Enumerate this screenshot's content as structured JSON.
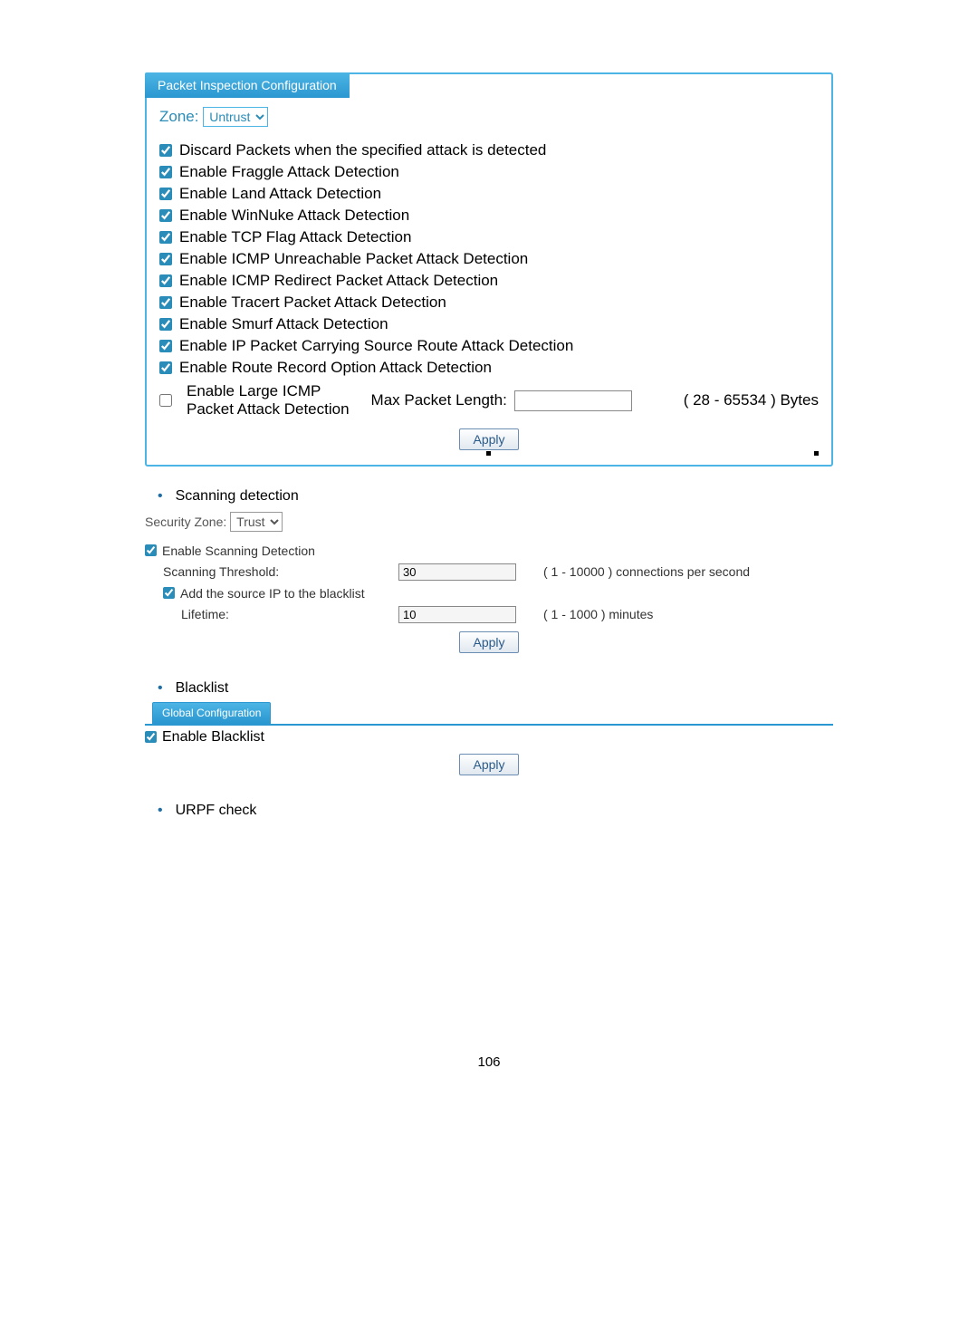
{
  "packetInspection": {
    "tabTitle": "Packet Inspection Configuration",
    "zoneLabel": "Zone:",
    "zoneValue": "Untrust",
    "options": [
      {
        "checked": true,
        "label": "Discard Packets when the specified attack is detected"
      },
      {
        "checked": true,
        "label": "Enable Fraggle Attack Detection"
      },
      {
        "checked": true,
        "label": "Enable Land Attack Detection"
      },
      {
        "checked": true,
        "label": "Enable WinNuke Attack Detection"
      },
      {
        "checked": true,
        "label": "Enable TCP Flag Attack Detection"
      },
      {
        "checked": true,
        "label": "Enable ICMP Unreachable Packet Attack Detection"
      },
      {
        "checked": true,
        "label": "Enable ICMP Redirect Packet Attack Detection"
      },
      {
        "checked": true,
        "label": "Enable Tracert Packet Attack Detection"
      },
      {
        "checked": true,
        "label": "Enable Smurf Attack Detection"
      },
      {
        "checked": true,
        "label": "Enable IP Packet Carrying Source Route Attack Detection"
      },
      {
        "checked": true,
        "label": "Enable Route Record Option Attack Detection"
      }
    ],
    "largeIcmp": {
      "checked": false,
      "labelLine1": "Enable Large ICMP",
      "labelLine2": "Packet Attack Detection",
      "maxLabel": "Max Packet Length:",
      "value": "",
      "range": "( 28 - 65534 ) Bytes"
    },
    "apply": "Apply"
  },
  "scanning": {
    "heading": "Scanning detection",
    "securityZoneLabel": "Security Zone:",
    "securityZoneValue": "Trust",
    "enableLabel": "Enable Scanning Detection",
    "enableChecked": true,
    "thresholdLabel": "Scanning Threshold:",
    "thresholdValue": "30",
    "thresholdRange": "( 1 - 10000 ) connections per second",
    "blacklistCheckLabel": "Add the source IP to the blacklist",
    "blacklistCheckChecked": true,
    "lifetimeLabel": "Lifetime:",
    "lifetimeValue": "10",
    "lifetimeRange": "( 1 - 1000 ) minutes",
    "apply": "Apply"
  },
  "blacklist": {
    "heading": "Blacklist",
    "tabTitle": "Global Configuration",
    "enableLabel": "Enable Blacklist",
    "enableChecked": true,
    "apply": "Apply"
  },
  "urpf": {
    "heading": "URPF check"
  },
  "pageNumber": "106"
}
